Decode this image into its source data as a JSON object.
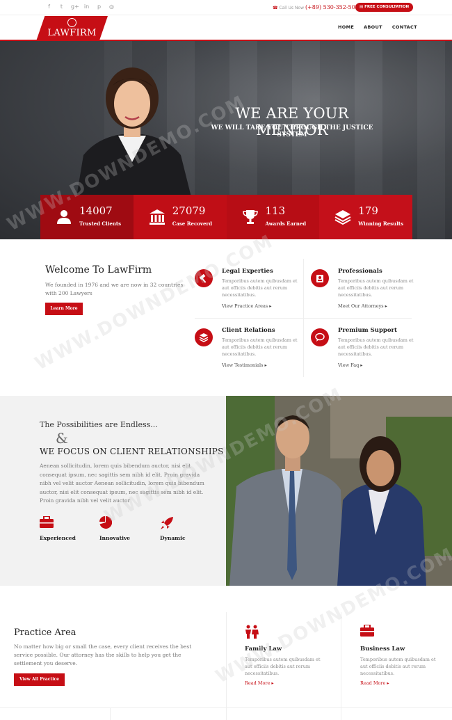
{
  "topbar": {
    "social_icons": [
      "facebook-icon",
      "twitter-icon",
      "google-plus-icon",
      "linkedin-icon",
      "pinterest-icon",
      "dribbble-icon"
    ],
    "call_label": "Call Us Now",
    "phone": "(+89) 530-352-5027",
    "consult_label": "FREE CONSULTATION"
  },
  "header": {
    "logo": "LAWFIRM",
    "nav": [
      "HOME",
      "ABOUT",
      "CONTACT"
    ]
  },
  "hero": {
    "title": "WE ARE YOUR MENTOR",
    "subtitle": "WE WILL TAKE YOU THROUGH THE JUSTICE SYSTEM",
    "stats": [
      {
        "value": "14007",
        "label": "Trusted Clients",
        "icon": "users-icon"
      },
      {
        "value": "27079",
        "label": "Case Recoverd",
        "icon": "courthouse-icon"
      },
      {
        "value": "113",
        "label": "Awards Earned",
        "icon": "trophy-icon"
      },
      {
        "value": "179",
        "label": "Winning Results",
        "icon": "layers-icon"
      }
    ]
  },
  "welcome": {
    "title": "Welcome To LawFirm",
    "text": "We founded in 1976 and we are now in 32 countries with 200 Lawyers",
    "button": "Learn More"
  },
  "features": [
    {
      "title": "Legal Experties",
      "text": "Temporibus autem quibusdam et aut officiis debitis aut rerum necessitatibus.",
      "link": "View Practice Areas ▸",
      "icon": "gavel-icon"
    },
    {
      "title": "Professionals",
      "text": "Temporibus autem quibusdam et aut officiis debitis aut rerum necessitatibus.",
      "link": "Meet Our Attorneys ▸",
      "icon": "person-icon"
    },
    {
      "title": "Client Relations",
      "text": "Temporibus autem quibusdam et aut officiis debitis aut rerum necessitatibus.",
      "link": "View Testimonials ▸",
      "icon": "database-icon"
    },
    {
      "title": "Premium Support",
      "text": "Temporibus autem quibusdam et aut officiis debitis aut rerum necessitatibus.",
      "link": "View Faq ▸",
      "icon": "chat-icon"
    }
  ],
  "relations": {
    "kicker": "The Possibilities are Endless...",
    "amp": "&",
    "title": "WE FOCUS ON CLIENT RELATIONSHIPS",
    "text": "Aenean sollicitudin, lorem quis bibendum auctor, nisi elit consequat ipsum, nec sagittis sem nibh id elit. Proin gravida nibh vel velit auctor Aenean sollicitudin, lorem quis bibendum auctor, nisi elit consequat ipsum, nec sagittis sem nibh id elit. Proin gravida nibh vel velit auctor",
    "pillars": [
      {
        "label": "Experienced",
        "icon": "briefcase-icon"
      },
      {
        "label": "Innovative",
        "icon": "pie-chart-icon"
      },
      {
        "label": "Dynamic",
        "icon": "rocket-icon"
      }
    ]
  },
  "practice": {
    "title": "Practice Area",
    "text": "No matter how big or small the case, every client receives the best service possible. Our attorney has the skills to help you get the settlement you deserve.",
    "button": "View All Practice",
    "areas": [
      {
        "title": "Family Law",
        "text": "Temporibus autem quibusdam et aut officiis debitis aut rerum necessitatibus.",
        "link": "Read More ▸",
        "icon": "family-icon"
      },
      {
        "title": "Business Law",
        "text": "Temporibus autem quibusdam et aut officiis debitis aut rerum necessitatibus.",
        "link": "Read More ▸",
        "icon": "briefcase-icon"
      }
    ]
  },
  "watermark": "WWW.DOWNDEMO.COM",
  "colors": {
    "accent": "#c60e15",
    "dark": "#222222",
    "muted": "#888888"
  }
}
